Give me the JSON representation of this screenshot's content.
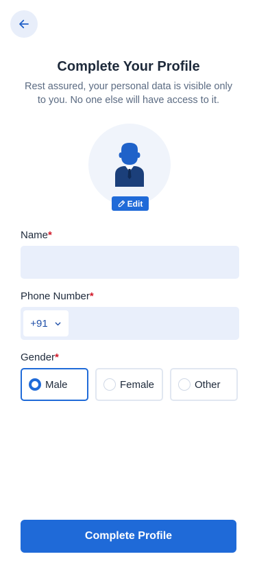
{
  "header": {
    "title": "Complete Your Profile",
    "subtitle": "Rest assured, your personal data is visible only to you. No one else will have access to it."
  },
  "avatar": {
    "icon": "user-avatar-icon",
    "edit_label": "Edit"
  },
  "form": {
    "name": {
      "label": "Name",
      "required_mark": "*",
      "value": "",
      "placeholder": ""
    },
    "phone": {
      "label": "Phone Number",
      "required_mark": "*",
      "country_code": "+91",
      "value": "",
      "placeholder": ""
    },
    "gender": {
      "label": "Gender",
      "required_mark": "*",
      "options": [
        {
          "label": "Male",
          "selected": true
        },
        {
          "label": "Female",
          "selected": false
        },
        {
          "label": "Other",
          "selected": false
        }
      ]
    }
  },
  "actions": {
    "submit_label": "Complete Profile"
  },
  "colors": {
    "primary": "#1f6ad8",
    "input_bg": "#e9effb",
    "required": "#d11a2a",
    "text": "#1e2a3b",
    "muted": "#5b6b82"
  }
}
